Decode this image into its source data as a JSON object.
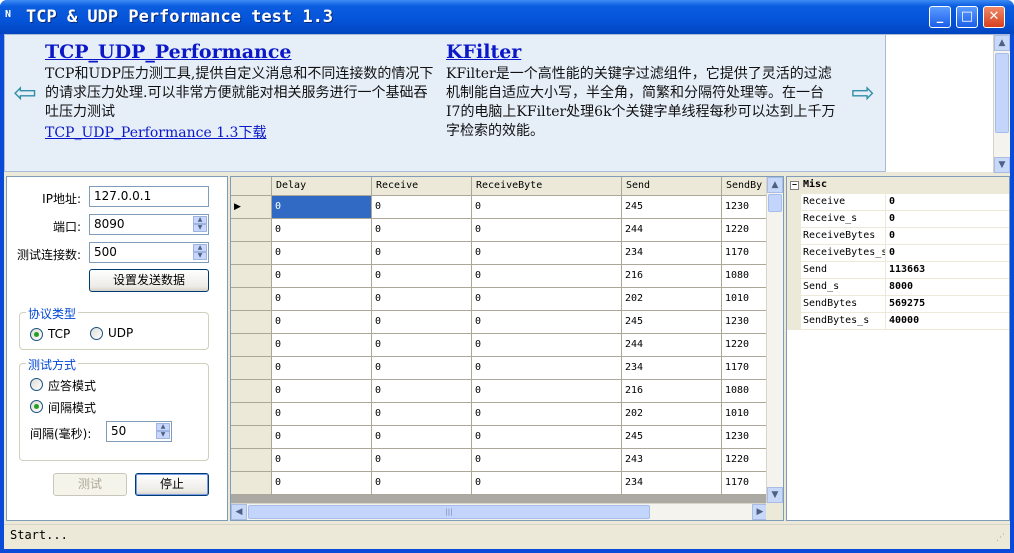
{
  "window": {
    "title": "TCP & UDP Performance test 1.3",
    "icon_text": "N"
  },
  "titlebar_buttons": {
    "minimize": "_",
    "maximize": "□",
    "close": "✕"
  },
  "banner": {
    "left": {
      "title": "TCP_UDP_Performance",
      "desc": "TCP和UDP压力测工具,提供自定义消息和不同连接数的情况下的请求压力处理.可以非常方便就能对相关服务进行一个基础吞吐压力测试",
      "link": "TCP_UDP_Performance 1.3下载"
    },
    "right": {
      "title": "KFilter",
      "desc": "KFilter是一个高性能的关键字过滤组件，它提供了灵活的过滤机制能自适应大小写，半全角，简繁和分隔符处理等。在一台I7的电脑上KFilter处理6k个关键字单线程每秒可以达到上千万字检索的效能。"
    },
    "prev_arrow": "⇦",
    "next_arrow": "⇨"
  },
  "settings": {
    "ip_label": "IP地址:",
    "ip_value": "127.0.0.1",
    "port_label": "端口:",
    "port_value": "8090",
    "conn_label": "测试连接数:",
    "conn_value": "500",
    "set_data_button": "设置发送数据",
    "protocol_group": "协议类型",
    "protocol_tcp": "TCP",
    "protocol_udp": "UDP",
    "protocol_selected": "TCP",
    "mode_group": "测试方式",
    "mode_response": "应答模式",
    "mode_interval": "间隔模式",
    "mode_selected": "间隔模式",
    "interval_label": "间隔(毫秒):",
    "interval_value": "50",
    "test_button": "测试",
    "stop_button": "停止"
  },
  "grid": {
    "columns": [
      "Delay",
      "Receive",
      "ReceiveByte",
      "Send",
      "SendBy"
    ],
    "current_row_marker": "▶",
    "rows": [
      [
        "0",
        "0",
        "0",
        "245",
        "1230"
      ],
      [
        "0",
        "0",
        "0",
        "244",
        "1220"
      ],
      [
        "0",
        "0",
        "0",
        "234",
        "1170"
      ],
      [
        "0",
        "0",
        "0",
        "216",
        "1080"
      ],
      [
        "0",
        "0",
        "0",
        "202",
        "1010"
      ],
      [
        "0",
        "0",
        "0",
        "245",
        "1230"
      ],
      [
        "0",
        "0",
        "0",
        "244",
        "1220"
      ],
      [
        "0",
        "0",
        "0",
        "234",
        "1170"
      ],
      [
        "0",
        "0",
        "0",
        "216",
        "1080"
      ],
      [
        "0",
        "0",
        "0",
        "202",
        "1010"
      ],
      [
        "0",
        "0",
        "0",
        "245",
        "1230"
      ],
      [
        "0",
        "0",
        "0",
        "243",
        "1220"
      ],
      [
        "0",
        "0",
        "0",
        "234",
        "1170"
      ]
    ],
    "hscroll_grip": "|||"
  },
  "properties": {
    "category": "Misc",
    "toggle": "−",
    "items": [
      {
        "name": "Receive",
        "value": "0"
      },
      {
        "name": "Receive_s",
        "value": "0"
      },
      {
        "name": "ReceiveBytes",
        "value": "0"
      },
      {
        "name": "ReceiveBytes_s",
        "value": "0"
      },
      {
        "name": "Send",
        "value": "113663"
      },
      {
        "name": "Send_s",
        "value": "8000"
      },
      {
        "name": "SendBytes",
        "value": "569275"
      },
      {
        "name": "SendBytes_s",
        "value": "40000"
      }
    ]
  },
  "status": {
    "text": "Start...",
    "grip": "⋰"
  },
  "colors": {
    "title_blue": "#0553d8",
    "link": "#0b18c8",
    "selection": "#316ac5",
    "radio_dot": "#21a121"
  }
}
